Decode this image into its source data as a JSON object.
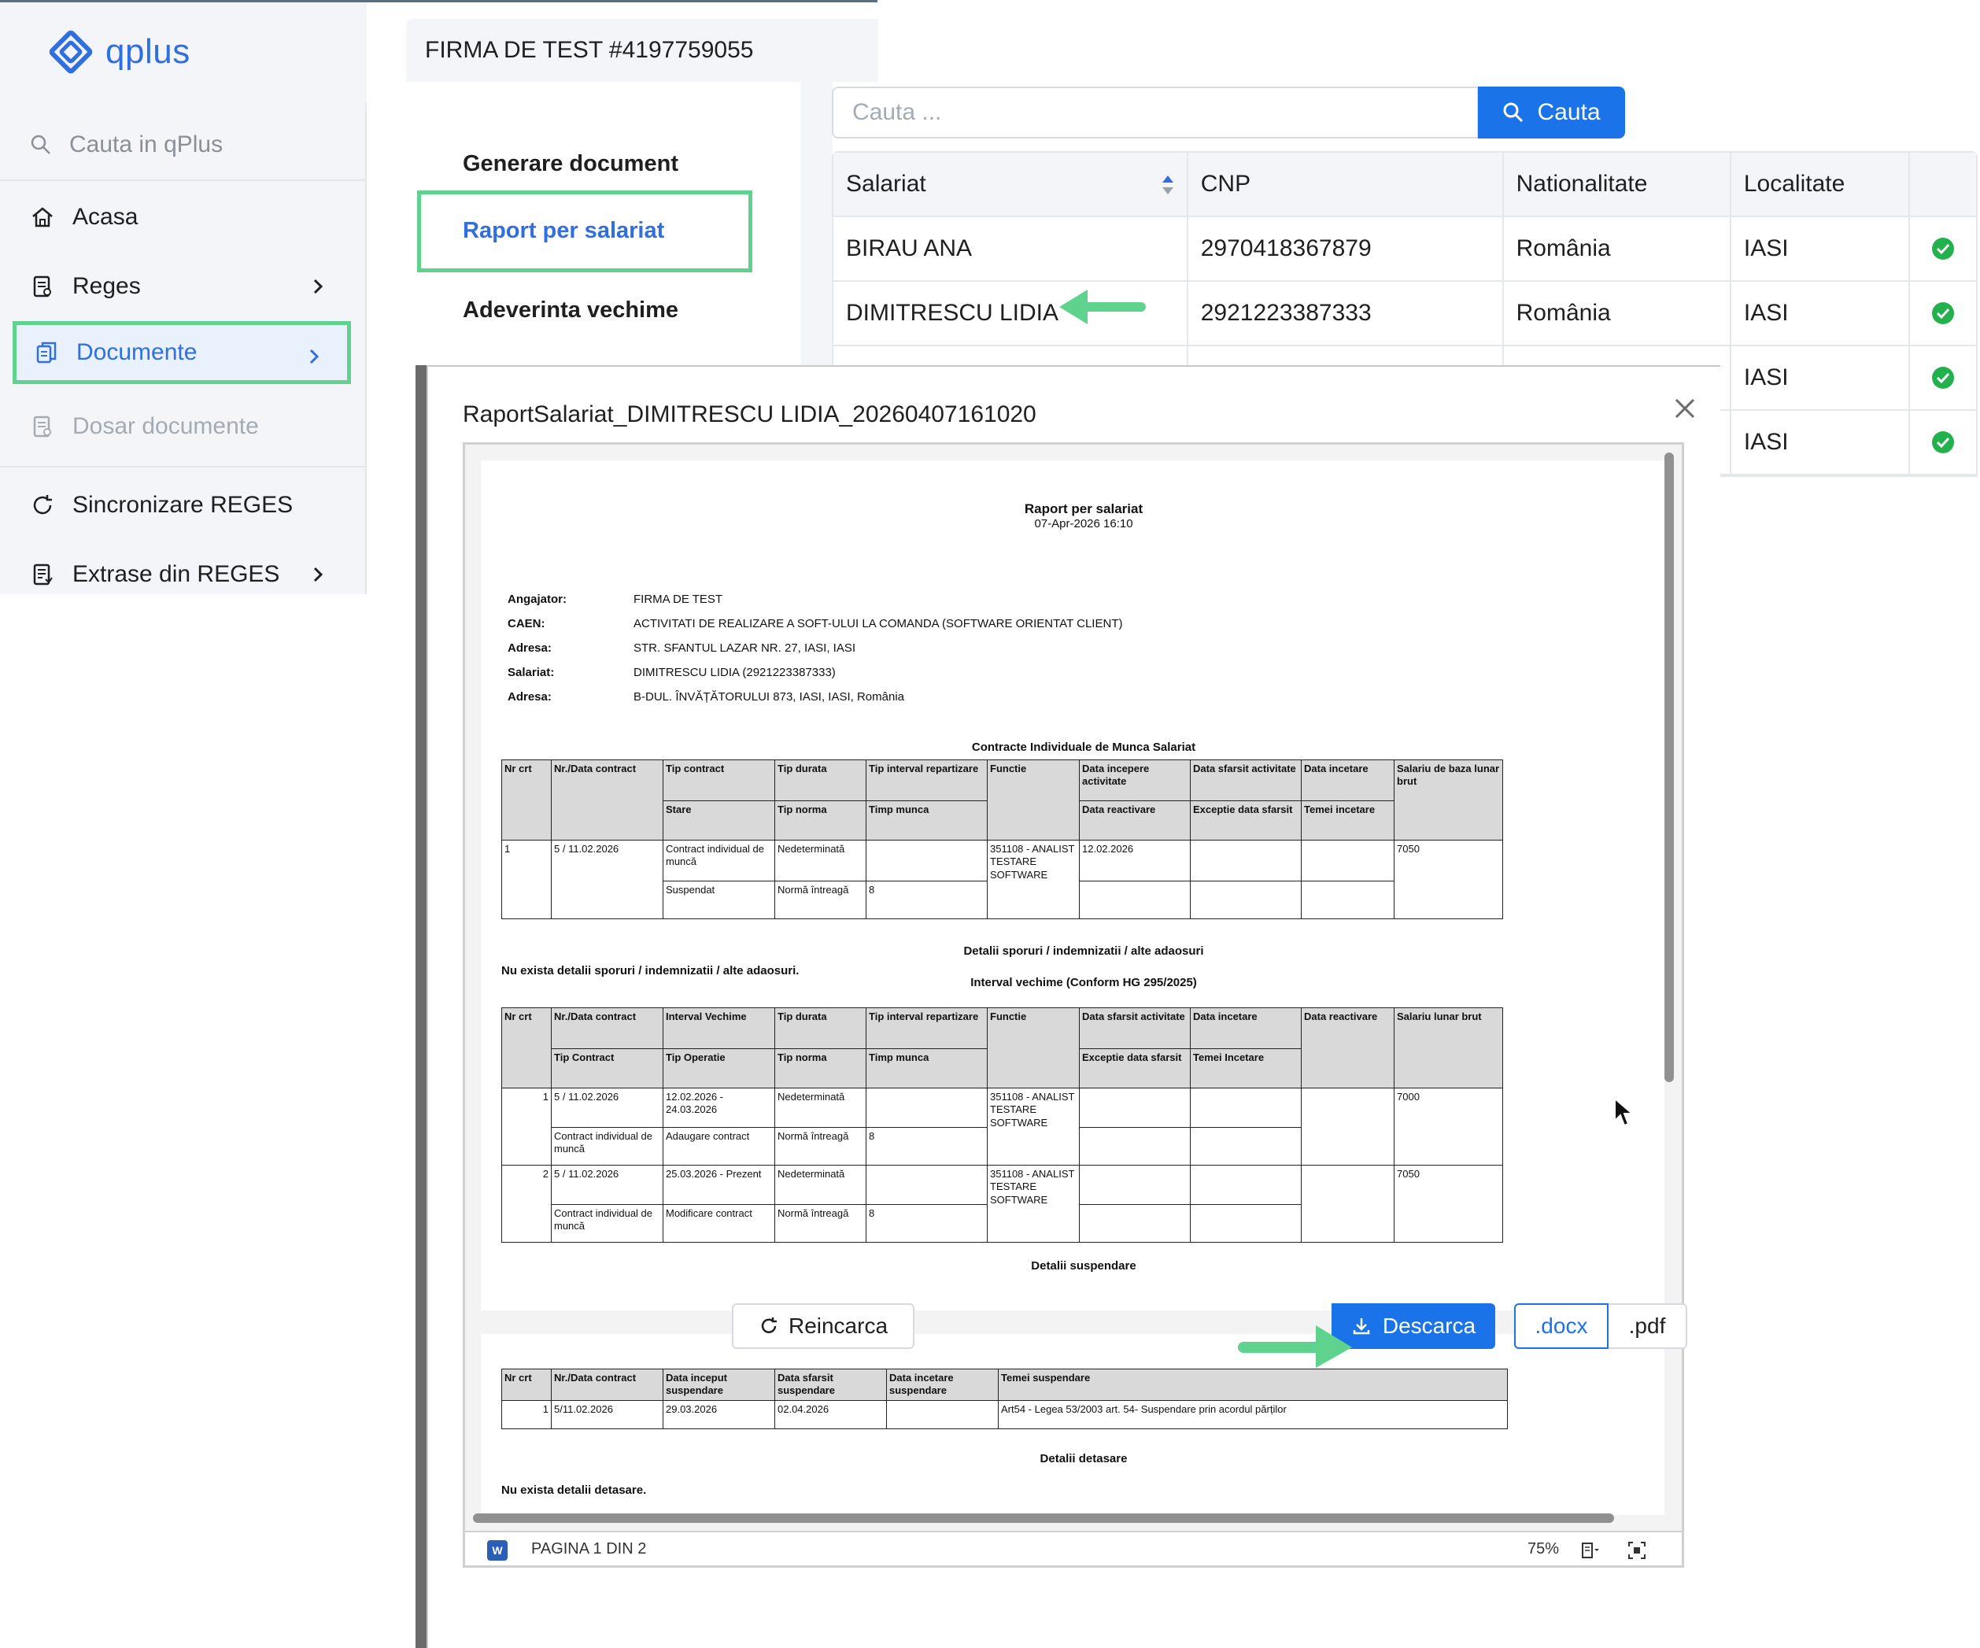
{
  "app": {
    "logo_text": "qplus",
    "firm_name": "FIRMA DE TEST #4197759055"
  },
  "sidebar": {
    "search_placeholder": "Cauta in qPlus",
    "items": [
      {
        "label": "Acasa",
        "icon": "home-icon"
      },
      {
        "label": "Reges",
        "icon": "document-icon"
      },
      {
        "label": "Documente",
        "icon": "documents-icon",
        "active": true
      },
      {
        "label": "Dosar documente",
        "icon": "folder-doc-icon",
        "disabled": true
      },
      {
        "label": "Sincronizare REGES",
        "icon": "sync-icon"
      },
      {
        "label": "Extrase din REGES",
        "icon": "extract-icon"
      }
    ]
  },
  "submenu": {
    "items": [
      "Generare document",
      "Raport per salariat",
      "Adeverinta vechime"
    ],
    "active": "Raport per salariat"
  },
  "search": {
    "placeholder": "Cauta ...",
    "button_label": "Cauta"
  },
  "table": {
    "headers": [
      "Salariat",
      "CNP",
      "Nationalitate",
      "Localitate"
    ],
    "rows": [
      {
        "salariat": "BIRAU ANA",
        "cnp": "2970418367879",
        "nationalitate": "România",
        "localitate": "IASI"
      },
      {
        "salariat": "DIMITRESCU LIDIA",
        "cnp": "2921223387333",
        "nationalitate": "România",
        "localitate": "IASI"
      },
      {
        "salariat": "",
        "cnp": "",
        "nationalitate": "",
        "localitate": "IASI"
      },
      {
        "salariat": "",
        "cnp": "",
        "nationalitate": "",
        "localitate": "IASI"
      }
    ]
  },
  "modal": {
    "title": "RaportSalariat_DIMITRESCU LIDIA_20260407161020",
    "page_label": "PAGINA 1 DIN 2",
    "zoom": "75%",
    "buttons": {
      "reload": "Reincarca",
      "download": "Descarca",
      "docx": ".docx",
      "pdf": ".pdf"
    }
  },
  "doc": {
    "title": "Raport per salariat",
    "date": "07-Apr-2026 16:10",
    "info": [
      {
        "label": "Angajator:",
        "value": "FIRMA DE TEST"
      },
      {
        "label": "CAEN:",
        "value": "ACTIVITATI DE REALIZARE A SOFT-ULUI LA COMANDA (SOFTWARE ORIENTAT CLIENT)"
      },
      {
        "label": "Adresa:",
        "value": "STR. SFANTUL LAZAR NR. 27, IASI, IASI"
      },
      {
        "label": "Salariat:",
        "value": "DIMITRESCU LIDIA (2921223387333)"
      },
      {
        "label": "Adresa:",
        "value": "B-DUL. ÎNVĂȚĂTORULUI 873, IASI, IASI, România"
      }
    ],
    "s1_title": "Contracte Individuale de Munca Salariat",
    "t1": {
      "h1": [
        "Nr crt",
        "Nr./Data contract",
        "Tip contract",
        "Tip durata",
        "Tip interval repartizare",
        "Functie",
        "Data incepere activitate",
        "Data sfarsit activitate",
        "Data incetare",
        "Salariu de baza lunar brut"
      ],
      "h2": [
        "Stare",
        "Tip norma",
        "Timp munca",
        "Data reactivare",
        "Exceptie data sfarsit",
        "Temei incetare"
      ],
      "r1": [
        "1",
        "5 / 11.02.2026",
        "Contract individual de muncă",
        "Nedeterminată",
        "",
        "351108 - ANALIST TESTARE SOFTWARE",
        "12.02.2026",
        "",
        "",
        "7050"
      ],
      "r2": [
        "Suspendat",
        "Normă întreagă",
        "8"
      ]
    },
    "s2_title": "Detalii sporuri / indemnizatii / alte adaosuri",
    "s2_text": "Nu exista detalii sporuri / indemnizatii / alte adaosuri.",
    "s3_title": "Interval vechime (Conform HG 295/2025)",
    "t2": {
      "h1": [
        "Nr crt",
        "Nr./Data contract",
        "Interval Vechime",
        "Tip durata",
        "Tip interval repartizare",
        "Functie",
        "Data sfarsit activitate",
        "Data incetare",
        "Data reactivare",
        "Salariu lunar brut"
      ],
      "h2": [
        "Tip Contract",
        "Tip Operatie",
        "Tip norma",
        "Timp munca",
        "Exceptie data sfarsit",
        "Temei Incetare"
      ],
      "rows": [
        {
          "nr": "1",
          "contract": "5 / 11.02.2026",
          "interval": "12.02.2026 - 24.03.2026",
          "durata": "Nedeterminată",
          "functie": "351108 - ANALIST TESTARE SOFTWARE",
          "salariu": "7000",
          "tip_contract": "Contract individual de muncă",
          "operatie": "Adaugare contract",
          "norma": "Normă întreagă",
          "timp": "8"
        },
        {
          "nr": "2",
          "contract": "5 / 11.02.2026",
          "interval": "25.03.2026 - Prezent",
          "durata": "Nedeterminată",
          "functie": "351108 - ANALIST TESTARE SOFTWARE",
          "salariu": "7050",
          "tip_contract": "Contract individual de muncă",
          "operatie": "Modificare contract",
          "norma": "Normă întreagă",
          "timp": "8"
        }
      ]
    },
    "s4_title": "Detalii suspendare",
    "t3": {
      "headers": [
        "Nr crt",
        "Nr./Data contract",
        "Data inceput suspendare",
        "Data sfarsit suspendare",
        "Data incetare suspendare",
        "Temei suspendare"
      ],
      "row": [
        "1",
        "5/11.02.2026",
        "29.03.2026",
        "02.04.2026",
        "",
        "Art54 - Legea 53/2003 art. 54- Suspendare prin acordul părților"
      ]
    },
    "s5_title": "Detalii detasare",
    "s5_text": "Nu exista detalii detasare."
  },
  "colors": {
    "accent": "#1a73e8",
    "highlight": "#5fd38d",
    "success": "#22b14c"
  }
}
